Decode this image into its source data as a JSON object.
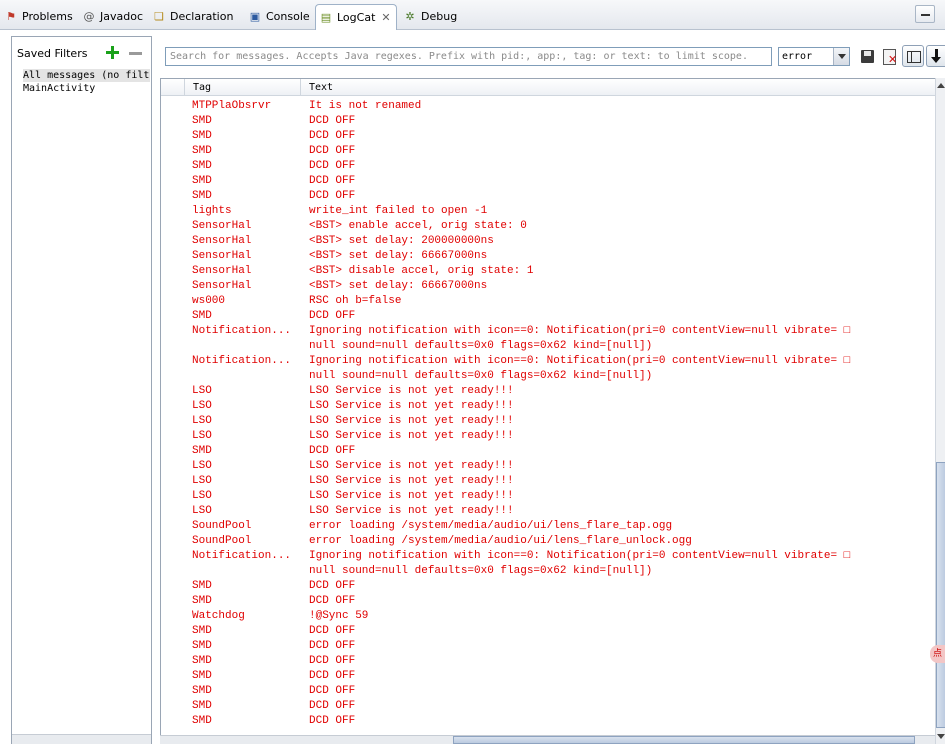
{
  "tabs": [
    {
      "label": "Problems",
      "icon": "problems-icon"
    },
    {
      "label": "Javadoc",
      "icon": "at-icon"
    },
    {
      "label": "Declaration",
      "icon": "declaration-icon"
    },
    {
      "label": "Console",
      "icon": "console-icon"
    },
    {
      "label": "LogCat",
      "icon": "logcat-icon",
      "active": true
    },
    {
      "label": "Debug",
      "icon": "debug-icon"
    }
  ],
  "filters": {
    "title": "Saved Filters",
    "items": [
      "All messages (no filters)",
      "MainActivity"
    ]
  },
  "search": {
    "placeholder": "Search for messages. Accepts Java regexes. Prefix with pid:, app:, tag: or text: to limit scope.",
    "value": ""
  },
  "level": {
    "selected": "error"
  },
  "columns": {
    "tag": "Tag",
    "text": "Text"
  },
  "log_color": "#e00000",
  "rows": [
    {
      "tag": "MTPPlaObsrvr",
      "text": "It is not renamed"
    },
    {
      "tag": "SMD",
      "text": "DCD OFF"
    },
    {
      "tag": "SMD",
      "text": "DCD OFF"
    },
    {
      "tag": "SMD",
      "text": "DCD OFF"
    },
    {
      "tag": "SMD",
      "text": "DCD OFF"
    },
    {
      "tag": "SMD",
      "text": "DCD OFF"
    },
    {
      "tag": "SMD",
      "text": "DCD OFF"
    },
    {
      "tag": "lights",
      "text": "write_int failed to open -1"
    },
    {
      "tag": "SensorHal",
      "text": "<BST> enable accel, orig state: 0"
    },
    {
      "tag": "SensorHal",
      "text": "<BST> set delay: 200000000ns"
    },
    {
      "tag": "SensorHal",
      "text": "<BST> set delay: 66667000ns"
    },
    {
      "tag": "SensorHal",
      "text": "<BST> disable accel, orig state: 1"
    },
    {
      "tag": "SensorHal",
      "text": "<BST> set delay: 66667000ns"
    },
    {
      "tag": "ws000",
      "text": "RSC oh b=false"
    },
    {
      "tag": "SMD",
      "text": "DCD OFF"
    },
    {
      "tag": "Notification...",
      "text": "Ignoring notification with icon==0: Notification(pri=0 contentView=null vibrate= □\nnull sound=null defaults=0x0 flags=0x62 kind=[null])"
    },
    {
      "tag": "Notification...",
      "text": "Ignoring notification with icon==0: Notification(pri=0 contentView=null vibrate= □\nnull sound=null defaults=0x0 flags=0x62 kind=[null])"
    },
    {
      "tag": "LSO",
      "text": "LSO Service is not yet ready!!!"
    },
    {
      "tag": "LSO",
      "text": "LSO Service is not yet ready!!!"
    },
    {
      "tag": "LSO",
      "text": "LSO Service is not yet ready!!!"
    },
    {
      "tag": "LSO",
      "text": "LSO Service is not yet ready!!!"
    },
    {
      "tag": "SMD",
      "text": "DCD OFF"
    },
    {
      "tag": "LSO",
      "text": "LSO Service is not yet ready!!!"
    },
    {
      "tag": "LSO",
      "text": "LSO Service is not yet ready!!!"
    },
    {
      "tag": "LSO",
      "text": "LSO Service is not yet ready!!!"
    },
    {
      "tag": "LSO",
      "text": "LSO Service is not yet ready!!!"
    },
    {
      "tag": "SoundPool",
      "text": "error loading /system/media/audio/ui/lens_flare_tap.ogg"
    },
    {
      "tag": "SoundPool",
      "text": "error loading /system/media/audio/ui/lens_flare_unlock.ogg"
    },
    {
      "tag": "Notification...",
      "text": "Ignoring notification with icon==0: Notification(pri=0 contentView=null vibrate= □\nnull sound=null defaults=0x0 flags=0x62 kind=[null])"
    },
    {
      "tag": "SMD",
      "text": "DCD OFF"
    },
    {
      "tag": "SMD",
      "text": "DCD OFF"
    },
    {
      "tag": "Watchdog",
      "text": "!@Sync 59"
    },
    {
      "tag": "SMD",
      "text": "DCD OFF"
    },
    {
      "tag": "SMD",
      "text": "DCD OFF"
    },
    {
      "tag": "SMD",
      "text": "DCD OFF"
    },
    {
      "tag": "SMD",
      "text": "DCD OFF"
    },
    {
      "tag": "SMD",
      "text": "DCD OFF"
    },
    {
      "tag": "SMD",
      "text": "DCD OFF"
    },
    {
      "tag": "SMD",
      "text": "DCD OFF"
    }
  ],
  "side_badge": "点"
}
